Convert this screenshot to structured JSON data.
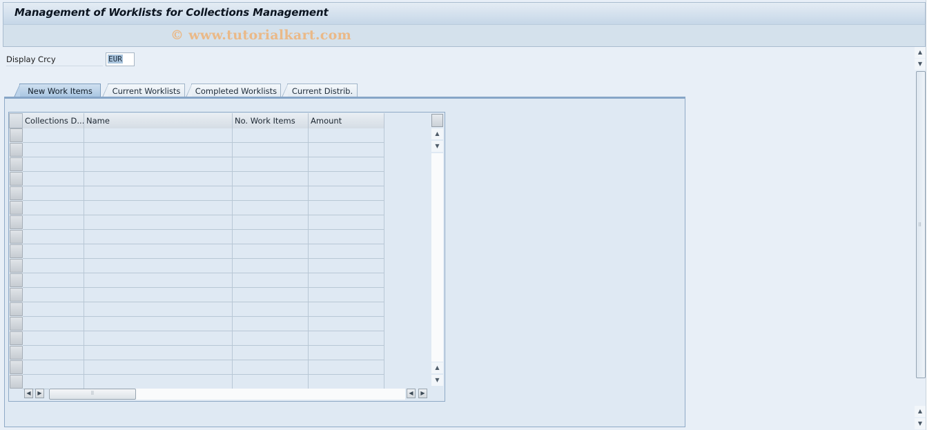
{
  "window": {
    "title": "Management of Worklists for Collections Management",
    "watermark": "© www.tutorialkart.com"
  },
  "form": {
    "display_currency_label": "Display Crcy",
    "display_currency_value": "EUR"
  },
  "tabs": [
    {
      "label": "New Work Items",
      "active": true
    },
    {
      "label": "Current Worklists",
      "active": false
    },
    {
      "label": "Completed Worklists",
      "active": false
    },
    {
      "label": "Current Distrib.",
      "active": false
    }
  ],
  "table": {
    "columns": [
      {
        "label": "Collections D..."
      },
      {
        "label": "Name"
      },
      {
        "label": "No. Work Items"
      },
      {
        "label": "Amount"
      }
    ],
    "rows": [
      [
        "",
        "",
        "",
        ""
      ],
      [
        "",
        "",
        "",
        ""
      ],
      [
        "",
        "",
        "",
        ""
      ],
      [
        "",
        "",
        "",
        ""
      ],
      [
        "",
        "",
        "",
        ""
      ],
      [
        "",
        "",
        "",
        ""
      ],
      [
        "",
        "",
        "",
        ""
      ],
      [
        "",
        "",
        "",
        ""
      ],
      [
        "",
        "",
        "",
        ""
      ],
      [
        "",
        "",
        "",
        ""
      ],
      [
        "",
        "",
        "",
        ""
      ],
      [
        "",
        "",
        "",
        ""
      ],
      [
        "",
        "",
        "",
        ""
      ],
      [
        "",
        "",
        "",
        ""
      ],
      [
        "",
        "",
        "",
        ""
      ],
      [
        "",
        "",
        "",
        ""
      ],
      [
        "",
        "",
        "",
        ""
      ],
      [
        "",
        "",
        "",
        ""
      ]
    ]
  },
  "icons": {
    "scroll_up": "▲",
    "scroll_down": "▼",
    "scroll_left": "◀",
    "scroll_right": "▶",
    "grip": "⠿"
  }
}
